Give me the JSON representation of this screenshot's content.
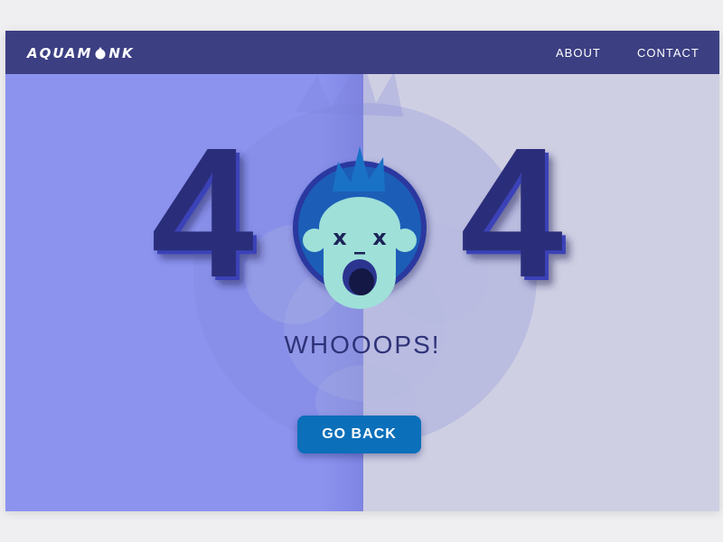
{
  "header": {
    "brand_prefix": "AQUAM",
    "brand_suffix": "NK",
    "nav": [
      {
        "label": "ABOUT"
      },
      {
        "label": "CONTACT"
      }
    ]
  },
  "main": {
    "digit_left": "4",
    "digit_right": "4",
    "headline": "WHOOOPS!",
    "button_label": "GO BACK",
    "monkey_eye_glyph": "x"
  },
  "colors": {
    "nav_bg": "#3c3f82",
    "left_panel": "#8b93ef",
    "right_panel": "#cfcfe3",
    "digit": "#2a2f7a",
    "digit_shade": "#3b43b8",
    "monkey_ring": "#2b38a0",
    "monkey_hair": "#1a72c7",
    "monkey_face": "#9fe0d8",
    "button": "#0b6fba"
  },
  "icons": {
    "brand_o": "monkey-head-icon",
    "mascot": "dead-monkey-icon"
  }
}
